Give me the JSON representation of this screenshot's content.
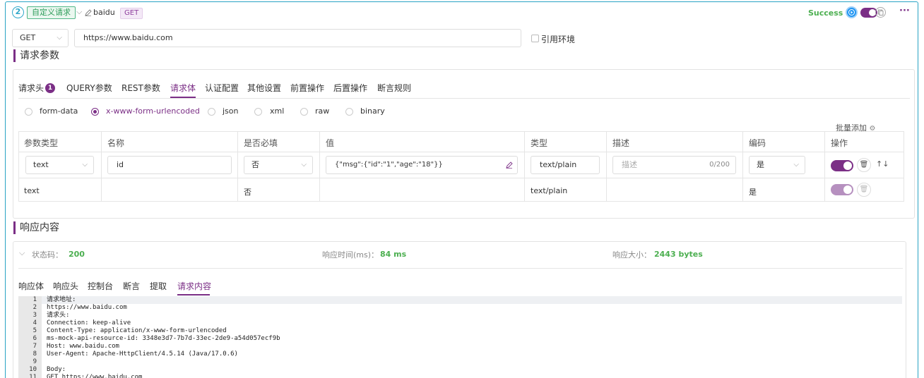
{
  "header": {
    "step_number": "2",
    "custom_tag": "自定义请求",
    "request_name": "baidu",
    "method_tag": "GET",
    "status_text": "Success"
  },
  "url_bar": {
    "method": "GET",
    "url": "https://www.baidu.com",
    "use_env_label": "引用环境"
  },
  "request_section": {
    "title": "请求参数",
    "tabs": [
      {
        "label": "请求头",
        "badge": "1"
      },
      {
        "label": "QUERY参数"
      },
      {
        "label": "REST参数"
      },
      {
        "label": "请求体"
      },
      {
        "label": "认证配置"
      },
      {
        "label": "其他设置"
      },
      {
        "label": "前置操作"
      },
      {
        "label": "后置操作"
      },
      {
        "label": "断言规则"
      }
    ],
    "active_tab": "请求体",
    "body_types": [
      "form-data",
      "x-www-form-urlencoded",
      "json",
      "xml",
      "raw",
      "binary"
    ],
    "selected_body_type": "x-www-form-urlencoded",
    "batch_add_label": "批量添加",
    "table": {
      "headers": [
        "参数类型",
        "名称",
        "是否必填",
        "值",
        "类型",
        "描述",
        "编码",
        "操作"
      ],
      "edit_row": {
        "param_type": "text",
        "name": "id",
        "required": "否",
        "value": "{\"msg\":{\"id\":\"1\",\"age\":\"18\"}}",
        "content_type": "text/plain",
        "desc_placeholder": "描述",
        "desc_count": "0/200",
        "encode": "是",
        "enabled": true
      },
      "rows": [
        {
          "param_type": "text",
          "name": "",
          "required": "否",
          "value": "",
          "content_type": "text/plain",
          "desc": "",
          "encode": "是",
          "enabled": true
        }
      ]
    }
  },
  "response_section": {
    "title": "响应内容",
    "status_label": "状态码：",
    "status_value": "200",
    "time_label": "响应时间(ms)：",
    "time_value": "84 ms",
    "size_label": "响应大小：",
    "size_value": "2443 bytes",
    "tabs": [
      "响应体",
      "响应头",
      "控制台",
      "断言",
      "提取",
      "请求内容"
    ],
    "active_tab": "请求内容",
    "code_lines": [
      "请求地址:",
      "https://www.baidu.com",
      "请求头:",
      "Connection: keep-alive",
      "Content-Type: application/x-www-form-urlencoded",
      "ms-mock-api-resource-id: 3348e3d7-7b7d-33ec-2de9-a54d057ecf9b",
      "Host: www.baidu.com",
      "User-Agent: Apache-HttpClient/4.5.14 (Java/17.0.6)",
      "",
      "Body:",
      "GET https://www.baidu.com"
    ]
  },
  "colors": {
    "accent": "#7b2f86",
    "success": "#4caf50",
    "step": "#2fa7c9",
    "play": "#2196f3"
  }
}
